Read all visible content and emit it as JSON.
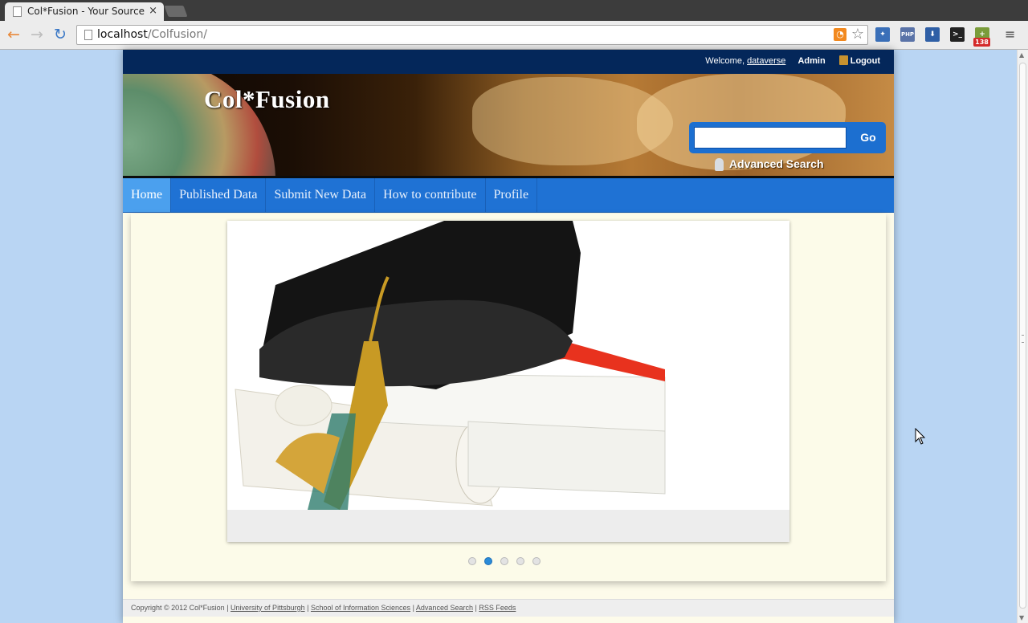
{
  "browser": {
    "tab_title": "Col*Fusion - Your Source f",
    "close_glyph": "×",
    "url_host": "localhost",
    "url_path": "/Colfusion/",
    "extension_badge": "138",
    "php_label": "PHP"
  },
  "topbar": {
    "welcome": "Welcome,",
    "username": "dataverse",
    "admin": "Admin",
    "logout": "Logout"
  },
  "header": {
    "site_title": "Col*Fusion",
    "search_value": "",
    "go_label": "Go",
    "advanced_search": "Advanced Search"
  },
  "nav": {
    "items": [
      {
        "label": "Home",
        "active": true
      },
      {
        "label": "Published Data",
        "active": false
      },
      {
        "label": "Submit New Data",
        "active": false
      },
      {
        "label": "How to contribute",
        "active": false
      },
      {
        "label": "Profile",
        "active": false
      }
    ]
  },
  "slider": {
    "slide_count": 5,
    "active_index": 1
  },
  "footer": {
    "copyright": "Copyright © 2012 Col*Fusion |",
    "links": [
      "University of Pittsburgh",
      "School of Information Sciences",
      "Advanced Search",
      "RSS Feeds"
    ],
    "separator": "|"
  },
  "icons": {
    "back": "back-arrow-icon",
    "forward": "forward-arrow-icon",
    "reload": "reload-icon",
    "rss": "rss-icon",
    "bookmark": "star-icon",
    "menu": "hamburger-menu-icon"
  },
  "colors": {
    "page_background": "#b9d5f3",
    "topbar": "#04275a",
    "navbar": "#1f72d4",
    "nav_active": "#4ba0ee",
    "search_box": "#1c6fd0",
    "content": "#fcfbe9"
  }
}
